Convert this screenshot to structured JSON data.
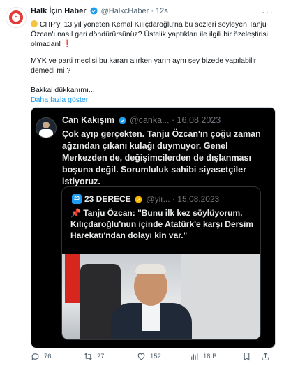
{
  "tweet": {
    "author_name": "Halk İçin Haber",
    "author_handle": "@HalkcHaber",
    "dot": "·",
    "time": "12s",
    "more": "···",
    "line1": "CHP'yl 13 yıl yöneten Kemal Kılıçdaroğlu'na bu sözleri söyleyen Tanju Özcan'ı nasıl geri döndürürsünüz? Üstelik yaptıkları ile ilgili bir özeleştirisi olmadan!",
    "line2": "MYK ve parti meclisi bu kararı alırken yarın aynı şey bizede yapılabilir demedi mi ?",
    "line3": "Bakkal dükkanımı...",
    "show_more": "Daha fazla göster"
  },
  "embedded": {
    "author_name": "Can Kakışım",
    "author_handle": "@canka...",
    "dot": "·",
    "date": "16.08.2023",
    "text": "Çok ayıp gerçekten. Tanju Özcan'ın çoğu zaman ağzından çıkanı kulağı duymuyor. Genel Merkezden de, değişimcilerden de dışlanması boşuna değil. Sorumluluk sahibi siyasetçiler istiyoruz.",
    "quote": {
      "badge": "23",
      "author_name": "23 DERECE",
      "author_handle": "@yir...",
      "dot": "·",
      "date": "15.08.2023",
      "text": "Tanju Özcan: \"Bunu ilk kez söylüyorum. Kılıçdaroğlu'nun içinde Atatürk'e karşı Dersim Harekatı'ndan dolayı kin var.\""
    }
  },
  "actions": {
    "replies": "76",
    "retweets": "27",
    "likes": "152",
    "views": "18 B"
  },
  "colors": {
    "verified": "#1d9bf0",
    "link": "#1d9bf0",
    "gold_badge": "#f5b400"
  }
}
